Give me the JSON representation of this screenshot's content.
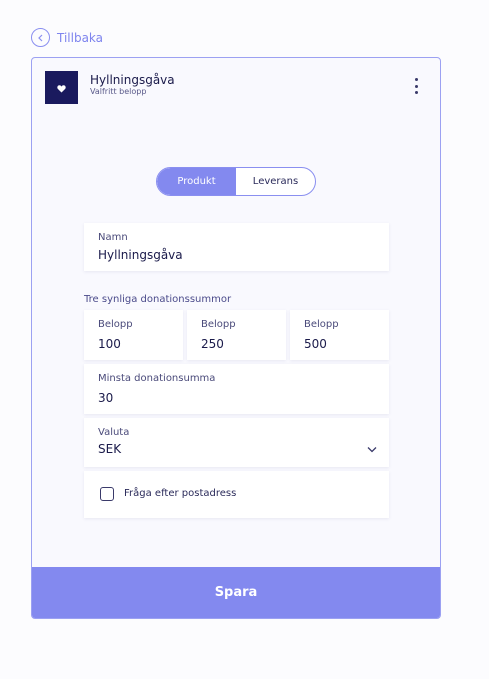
{
  "back": {
    "label": "Tillbaka"
  },
  "product": {
    "title": "Hyllningsgåva",
    "subtitle": "Valfritt belopp"
  },
  "tabs": [
    {
      "label": "Produkt",
      "active": true
    },
    {
      "label": "Leverans",
      "active": false
    }
  ],
  "form": {
    "name": {
      "label": "Namn",
      "value": "Hyllningsgåva"
    },
    "amounts_label": "Tre synliga donationssummor",
    "amounts": [
      {
        "label": "Belopp",
        "value": "100"
      },
      {
        "label": "Belopp",
        "value": "250"
      },
      {
        "label": "Belopp",
        "value": "500"
      }
    ],
    "min_amount": {
      "label": "Minsta donationsumma",
      "value": "30"
    },
    "currency": {
      "label": "Valuta",
      "value": "SEK"
    },
    "address_checkbox": {
      "label": "Fråga efter postadress",
      "checked": false
    }
  },
  "save_label": "Spara",
  "colors": {
    "accent": "#8389ef",
    "dark": "#1a1a5e"
  },
  "icons": {
    "back": "chevron-left-icon",
    "logo": "heart-icon",
    "menu": "kebab-menu-icon",
    "select": "chevron-down-icon"
  }
}
